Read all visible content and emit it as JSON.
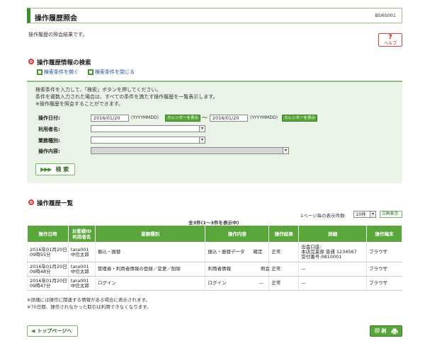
{
  "header": {
    "title": "操作履歴照会",
    "screen_code": "BSRS001"
  },
  "intro": "操作履歴の照会結果です。",
  "help": {
    "icon": "?",
    "label": "ヘルプ"
  },
  "search_section": {
    "title": "操作履歴情報の検索",
    "open_label": "検索条件を開く",
    "close_label": "検索条件を閉じる",
    "instructions": [
      "検索条件を入力して、「検索」ボタンを押してください。",
      "条件を複数入力された場合は、すべての条件を満たす操作履歴を一覧表示します。",
      "※操作履歴を照会することができます。"
    ],
    "date_label": "操作日付:",
    "date_from": "2016/01/20",
    "date_to": "2016/01/20",
    "date_hint": "(YYYYMMDD)",
    "calendar_label": "カレンダーを表示",
    "range_sep": "〜",
    "user_label": "利用者名:",
    "category_label": "業務種別:",
    "content_label": "操作内容:",
    "search_label": "検 索",
    "search_arrows": "▶▶▶"
  },
  "results_section": {
    "title": "操作履歴一覧",
    "per_page_label": "1ページ毎の表示件数:",
    "per_page_value": "10件",
    "per_page_button": "再表示",
    "count_text": "全3件(1〜3件を表示中)",
    "columns": [
      "操作日時",
      "お客様ID\n利用者名",
      "業務種別",
      "操作内容",
      "操作結果",
      "詳細",
      "操作端末"
    ],
    "rows": [
      {
        "datetime": [
          "2016年01月20日",
          "09時55分"
        ],
        "user": [
          "tara001",
          "中信太郎"
        ],
        "category": "振込・振替",
        "content": "振込・振替データ",
        "status": "確定",
        "result": "正常",
        "detail": [
          "出金口座:",
          "本店営業部 普通 1234567",
          "受付番号:0810001"
        ],
        "terminal": "ブラウザ"
      },
      {
        "datetime": [
          "2016年01月20日",
          "09時48分"
        ],
        "user": [
          "tara001",
          "中信太郎"
        ],
        "category": "管理者・利用者情報の登録／変更／削除",
        "content": "利用者情報",
        "status": "照会",
        "result": "正常",
        "detail": [
          "—"
        ],
        "terminal": "ブラウザ"
      },
      {
        "datetime": [
          "2016年01月20日",
          "09時47分"
        ],
        "user": [
          "tara001",
          "中信太郎"
        ],
        "category": "ログイン",
        "content": "ログイン",
        "status": "—",
        "result": "正常",
        "detail": [
          "—"
        ],
        "terminal": "ブラウザ"
      }
    ],
    "notes": [
      "※詳細には操作に関連する情報がある場合に表示されます。",
      "※70日間、操作されなかった取引は利用できなくなります。"
    ]
  },
  "footer": {
    "top_label": "トップページへ",
    "top_arrow": "◀",
    "print_label": "印 刷"
  },
  "colors": {
    "brand_green": "#5aa63c",
    "panel_bg": "#eaf4e6",
    "accent_red": "#d33333"
  }
}
